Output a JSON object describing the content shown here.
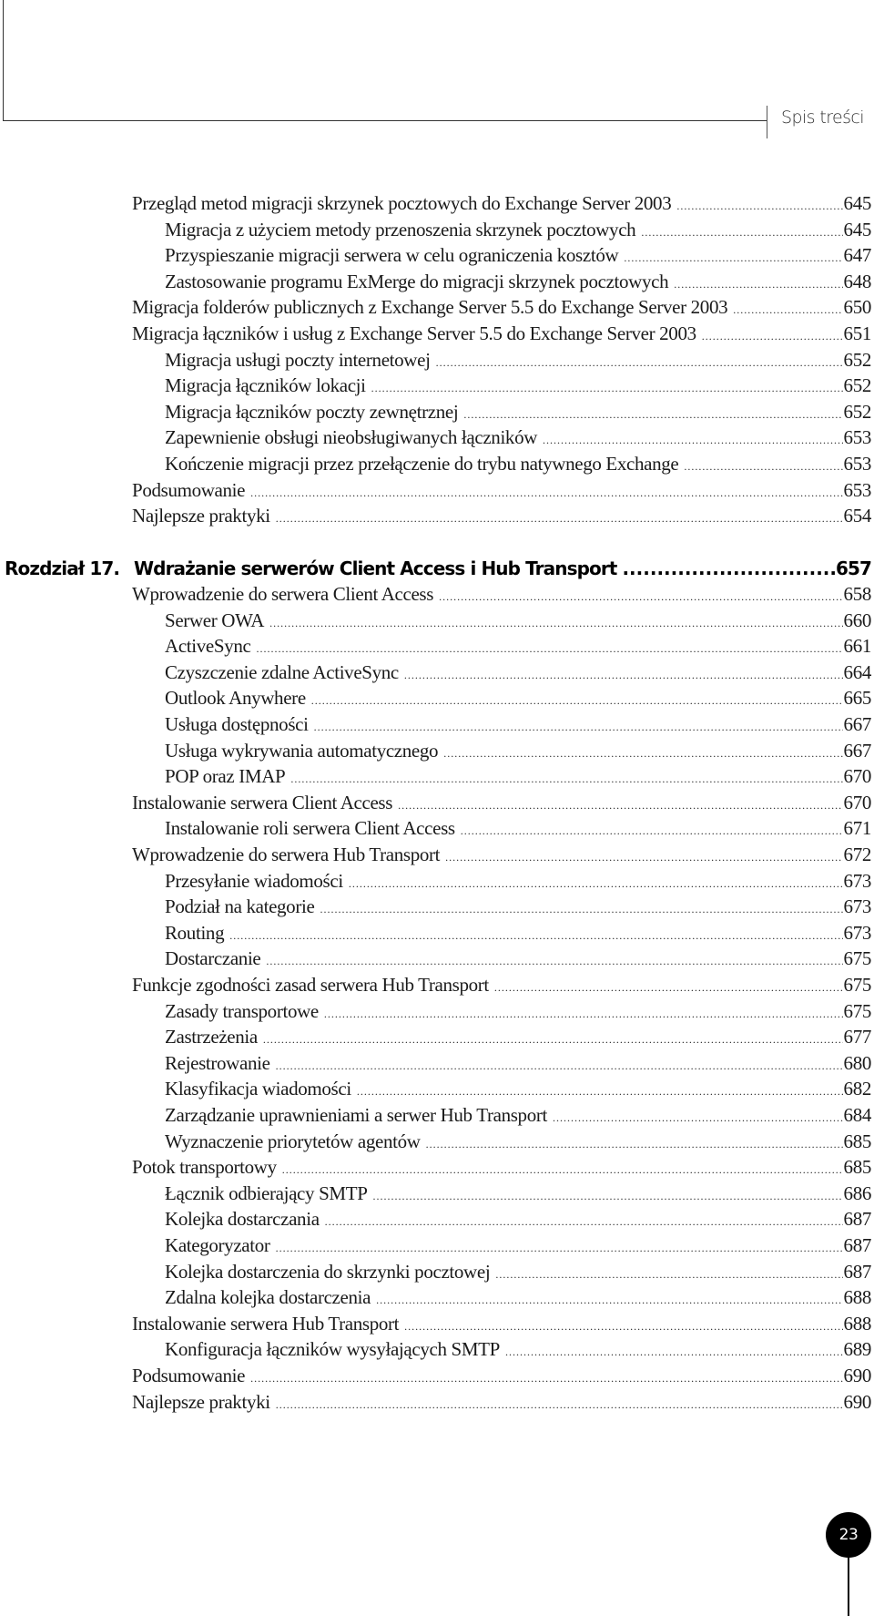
{
  "header": {
    "running_title": "Spis treści"
  },
  "section_a": [
    {
      "level": 1,
      "title": "Przegląd metod migracji skrzynek pocztowych do Exchange Server 2003",
      "page": "645"
    },
    {
      "level": 2,
      "title": "Migracja z użyciem metody przenoszenia skrzynek pocztowych",
      "page": "645"
    },
    {
      "level": 2,
      "title": "Przyspieszanie migracji serwera w celu ograniczenia kosztów",
      "page": "647"
    },
    {
      "level": 2,
      "title": "Zastosowanie programu ExMerge do migracji skrzynek pocztowych",
      "page": "648"
    },
    {
      "level": 1,
      "title": "Migracja folderów publicznych z Exchange Server 5.5 do Exchange Server 2003",
      "page": "650"
    },
    {
      "level": 1,
      "title": "Migracja łączników i usług z Exchange Server 5.5 do Exchange Server 2003",
      "page": "651"
    },
    {
      "level": 2,
      "title": "Migracja usługi poczty internetowej",
      "page": "652"
    },
    {
      "level": 2,
      "title": "Migracja łączników lokacji",
      "page": "652"
    },
    {
      "level": 2,
      "title": "Migracja łączników poczty zewnętrznej",
      "page": "652"
    },
    {
      "level": 2,
      "title": "Zapewnienie obsługi nieobsługiwanych łączników",
      "page": "653"
    },
    {
      "level": 2,
      "title": "Kończenie migracji przez przełączenie do trybu natywnego Exchange",
      "page": "653"
    },
    {
      "level": 1,
      "title": "Podsumowanie",
      "page": "653"
    },
    {
      "level": 1,
      "title": "Najlepsze praktyki",
      "page": "654"
    }
  ],
  "chapter": {
    "number": "Rozdział 17.",
    "title": "Wdrażanie serwerów Client Access i Hub Transport",
    "page": "657"
  },
  "section_b": [
    {
      "level": 1,
      "title": "Wprowadzenie do serwera Client Access",
      "page": "658"
    },
    {
      "level": 2,
      "title": "Serwer OWA",
      "page": "660"
    },
    {
      "level": 2,
      "title": "ActiveSync",
      "page": "661"
    },
    {
      "level": 2,
      "title": "Czyszczenie zdalne ActiveSync",
      "page": "664"
    },
    {
      "level": 2,
      "title": "Outlook Anywhere",
      "page": "665"
    },
    {
      "level": 2,
      "title": "Usługa dostępności",
      "page": "667"
    },
    {
      "level": 2,
      "title": "Usługa wykrywania automatycznego",
      "page": "667"
    },
    {
      "level": 2,
      "title": "POP oraz IMAP",
      "page": "670"
    },
    {
      "level": 1,
      "title": "Instalowanie serwera Client Access",
      "page": "670"
    },
    {
      "level": 2,
      "title": "Instalowanie roli serwera Client Access",
      "page": "671"
    },
    {
      "level": 1,
      "title": "Wprowadzenie do serwera Hub Transport",
      "page": "672"
    },
    {
      "level": 2,
      "title": "Przesyłanie wiadomości",
      "page": "673"
    },
    {
      "level": 2,
      "title": "Podział na kategorie",
      "page": "673"
    },
    {
      "level": 2,
      "title": "Routing",
      "page": "673"
    },
    {
      "level": 2,
      "title": "Dostarczanie",
      "page": "675"
    },
    {
      "level": 1,
      "title": "Funkcje zgodności zasad serwera Hub Transport",
      "page": "675"
    },
    {
      "level": 2,
      "title": "Zasady transportowe",
      "page": "675"
    },
    {
      "level": 2,
      "title": "Zastrzeżenia",
      "page": "677"
    },
    {
      "level": 2,
      "title": "Rejestrowanie",
      "page": "680"
    },
    {
      "level": 2,
      "title": "Klasyfikacja wiadomości",
      "page": "682"
    },
    {
      "level": 2,
      "title": "Zarządzanie uprawnieniami a serwer Hub Transport",
      "page": "684"
    },
    {
      "level": 2,
      "title": "Wyznaczenie priorytetów agentów",
      "page": "685"
    },
    {
      "level": 1,
      "title": "Potok transportowy",
      "page": "685"
    },
    {
      "level": 2,
      "title": "Łącznik odbierający SMTP",
      "page": "686"
    },
    {
      "level": 2,
      "title": "Kolejka dostarczania",
      "page": "687"
    },
    {
      "level": 2,
      "title": "Kategoryzator",
      "page": "687"
    },
    {
      "level": 2,
      "title": "Kolejka dostarczenia do skrzynki pocztowej",
      "page": "687"
    },
    {
      "level": 2,
      "title": "Zdalna kolejka dostarczenia",
      "page": "688"
    },
    {
      "level": 1,
      "title": "Instalowanie serwera Hub Transport",
      "page": "688"
    },
    {
      "level": 2,
      "title": "Konfiguracja łączników wysyłających SMTP",
      "page": "689"
    },
    {
      "level": 1,
      "title": "Podsumowanie",
      "page": "690"
    },
    {
      "level": 1,
      "title": "Najlepsze praktyki",
      "page": "690"
    }
  ],
  "footer": {
    "page_number": "23"
  }
}
